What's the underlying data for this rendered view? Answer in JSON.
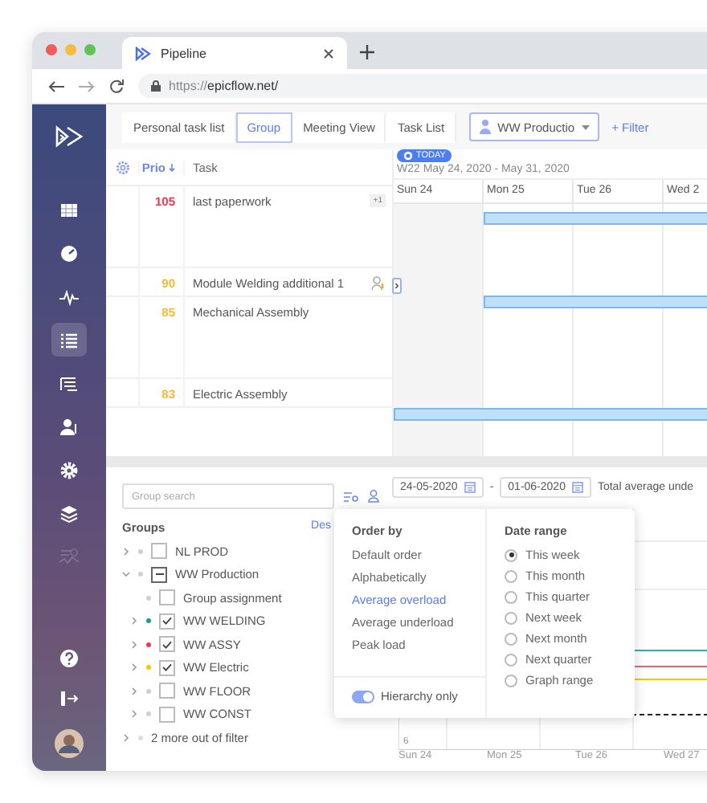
{
  "browser": {
    "tab_title": "Pipeline",
    "url_scheme": "https://",
    "url_host": "epicflow.net/"
  },
  "sidebar": {
    "items": [
      {
        "selected": false,
        "disabled": false
      },
      {
        "selected": false,
        "disabled": false
      },
      {
        "selected": false,
        "disabled": false
      },
      {
        "selected": true,
        "disabled": false
      },
      {
        "selected": false,
        "disabled": false
      },
      {
        "selected": false,
        "disabled": false
      },
      {
        "selected": false,
        "disabled": false
      },
      {
        "selected": false,
        "disabled": false
      },
      {
        "selected": false,
        "disabled": true
      }
    ]
  },
  "view_tabs": [
    {
      "label": "Personal task list",
      "selected": false
    },
    {
      "label": "Group",
      "selected": true
    },
    {
      "label": "Meeting View",
      "selected": false
    },
    {
      "label": "Task List",
      "selected": false
    }
  ],
  "group_dropdown": {
    "value": "WW Productio"
  },
  "filter_link": "+ Filter",
  "task_table": {
    "columns": [
      "Prio",
      "Task"
    ],
    "rows": [
      {
        "prio": "105",
        "color": "#f0364e",
        "task": "last paperwork",
        "badge": "+1",
        "assignee_icon": false,
        "kind": "late-start"
      },
      {
        "prio": "90",
        "color": "#f5b935",
        "task": "Module Welding additional 1",
        "assignee_icon": true,
        "kind": "late-start"
      },
      {
        "prio": "85",
        "color": "#f5b935",
        "task": "Mechanical Assembly",
        "assignee_icon": false,
        "kind": "unscheduled"
      },
      {
        "prio": "83",
        "color": "#f5b935",
        "task": "Electric Assembly",
        "assignee_icon": false,
        "kind": "full-week"
      }
    ]
  },
  "gantt": {
    "today_badge": "TODAY",
    "week": "W22 May 24, 2020 - May 31, 2020",
    "days": [
      "Sun 24",
      "Mon 25",
      "Tue 26",
      "Wed 2"
    ]
  },
  "groups_panel": {
    "search_placeholder": "Group search",
    "heading": "Groups",
    "deselect_link": "Des",
    "tree": [
      {
        "label": "NL PROD",
        "kind": "group",
        "expanded": false,
        "checked": false,
        "partial": false,
        "color": "#d0d0d0"
      },
      {
        "label": "WW Production",
        "kind": "group",
        "expanded": true,
        "checked": false,
        "partial": true,
        "color": "#d0d0d0",
        "children": [
          {
            "label": "Group assignment",
            "kind": "leaf",
            "checked": false,
            "partial": false,
            "color": "#d0d0d0"
          },
          {
            "label": "WW WELDING",
            "kind": "group",
            "expanded": false,
            "checked": true,
            "partial": false,
            "color": "#1a9e8a"
          },
          {
            "label": "WW ASSY",
            "kind": "group",
            "expanded": false,
            "checked": true,
            "partial": false,
            "color": "#f0364e"
          },
          {
            "label": "WW Electric",
            "kind": "group",
            "expanded": false,
            "checked": true,
            "partial": false,
            "color": "#f5c800"
          },
          {
            "label": "WW FLOOR",
            "kind": "group",
            "expanded": false,
            "checked": false,
            "partial": false,
            "color": "#d0d0d0"
          },
          {
            "label": "WW CONST",
            "kind": "group",
            "expanded": false,
            "checked": false,
            "partial": false,
            "color": "#d0d0d0"
          }
        ]
      }
    ],
    "more": "2 more out of filter"
  },
  "load_chart": {
    "date_from": "24-05-2020",
    "separator": "-",
    "date_to": "01-06-2020",
    "total_label": "Total average unde",
    "y_tick": "6",
    "x_labels": [
      "Sun 24",
      "Mon 25",
      "Tue 26",
      "Wed 27"
    ]
  },
  "popup": {
    "order_heading": "Order by",
    "order_options": [
      {
        "label": "Default order",
        "selected": false
      },
      {
        "label": "Alphabetically",
        "selected": false
      },
      {
        "label": "Average overload",
        "selected": true
      },
      {
        "label": "Average underload",
        "selected": false
      },
      {
        "label": "Peak load",
        "selected": false
      }
    ],
    "hierarchy_toggle": {
      "label": "Hierarchy only",
      "on": true
    },
    "range_heading": "Date range",
    "range_options": [
      {
        "label": "This week",
        "selected": true
      },
      {
        "label": "This month",
        "selected": false
      },
      {
        "label": "This quarter",
        "selected": false
      },
      {
        "label": "Next week",
        "selected": false
      },
      {
        "label": "Next month",
        "selected": false
      },
      {
        "label": "Next quarter",
        "selected": false
      },
      {
        "label": "Graph range",
        "selected": false
      }
    ]
  }
}
